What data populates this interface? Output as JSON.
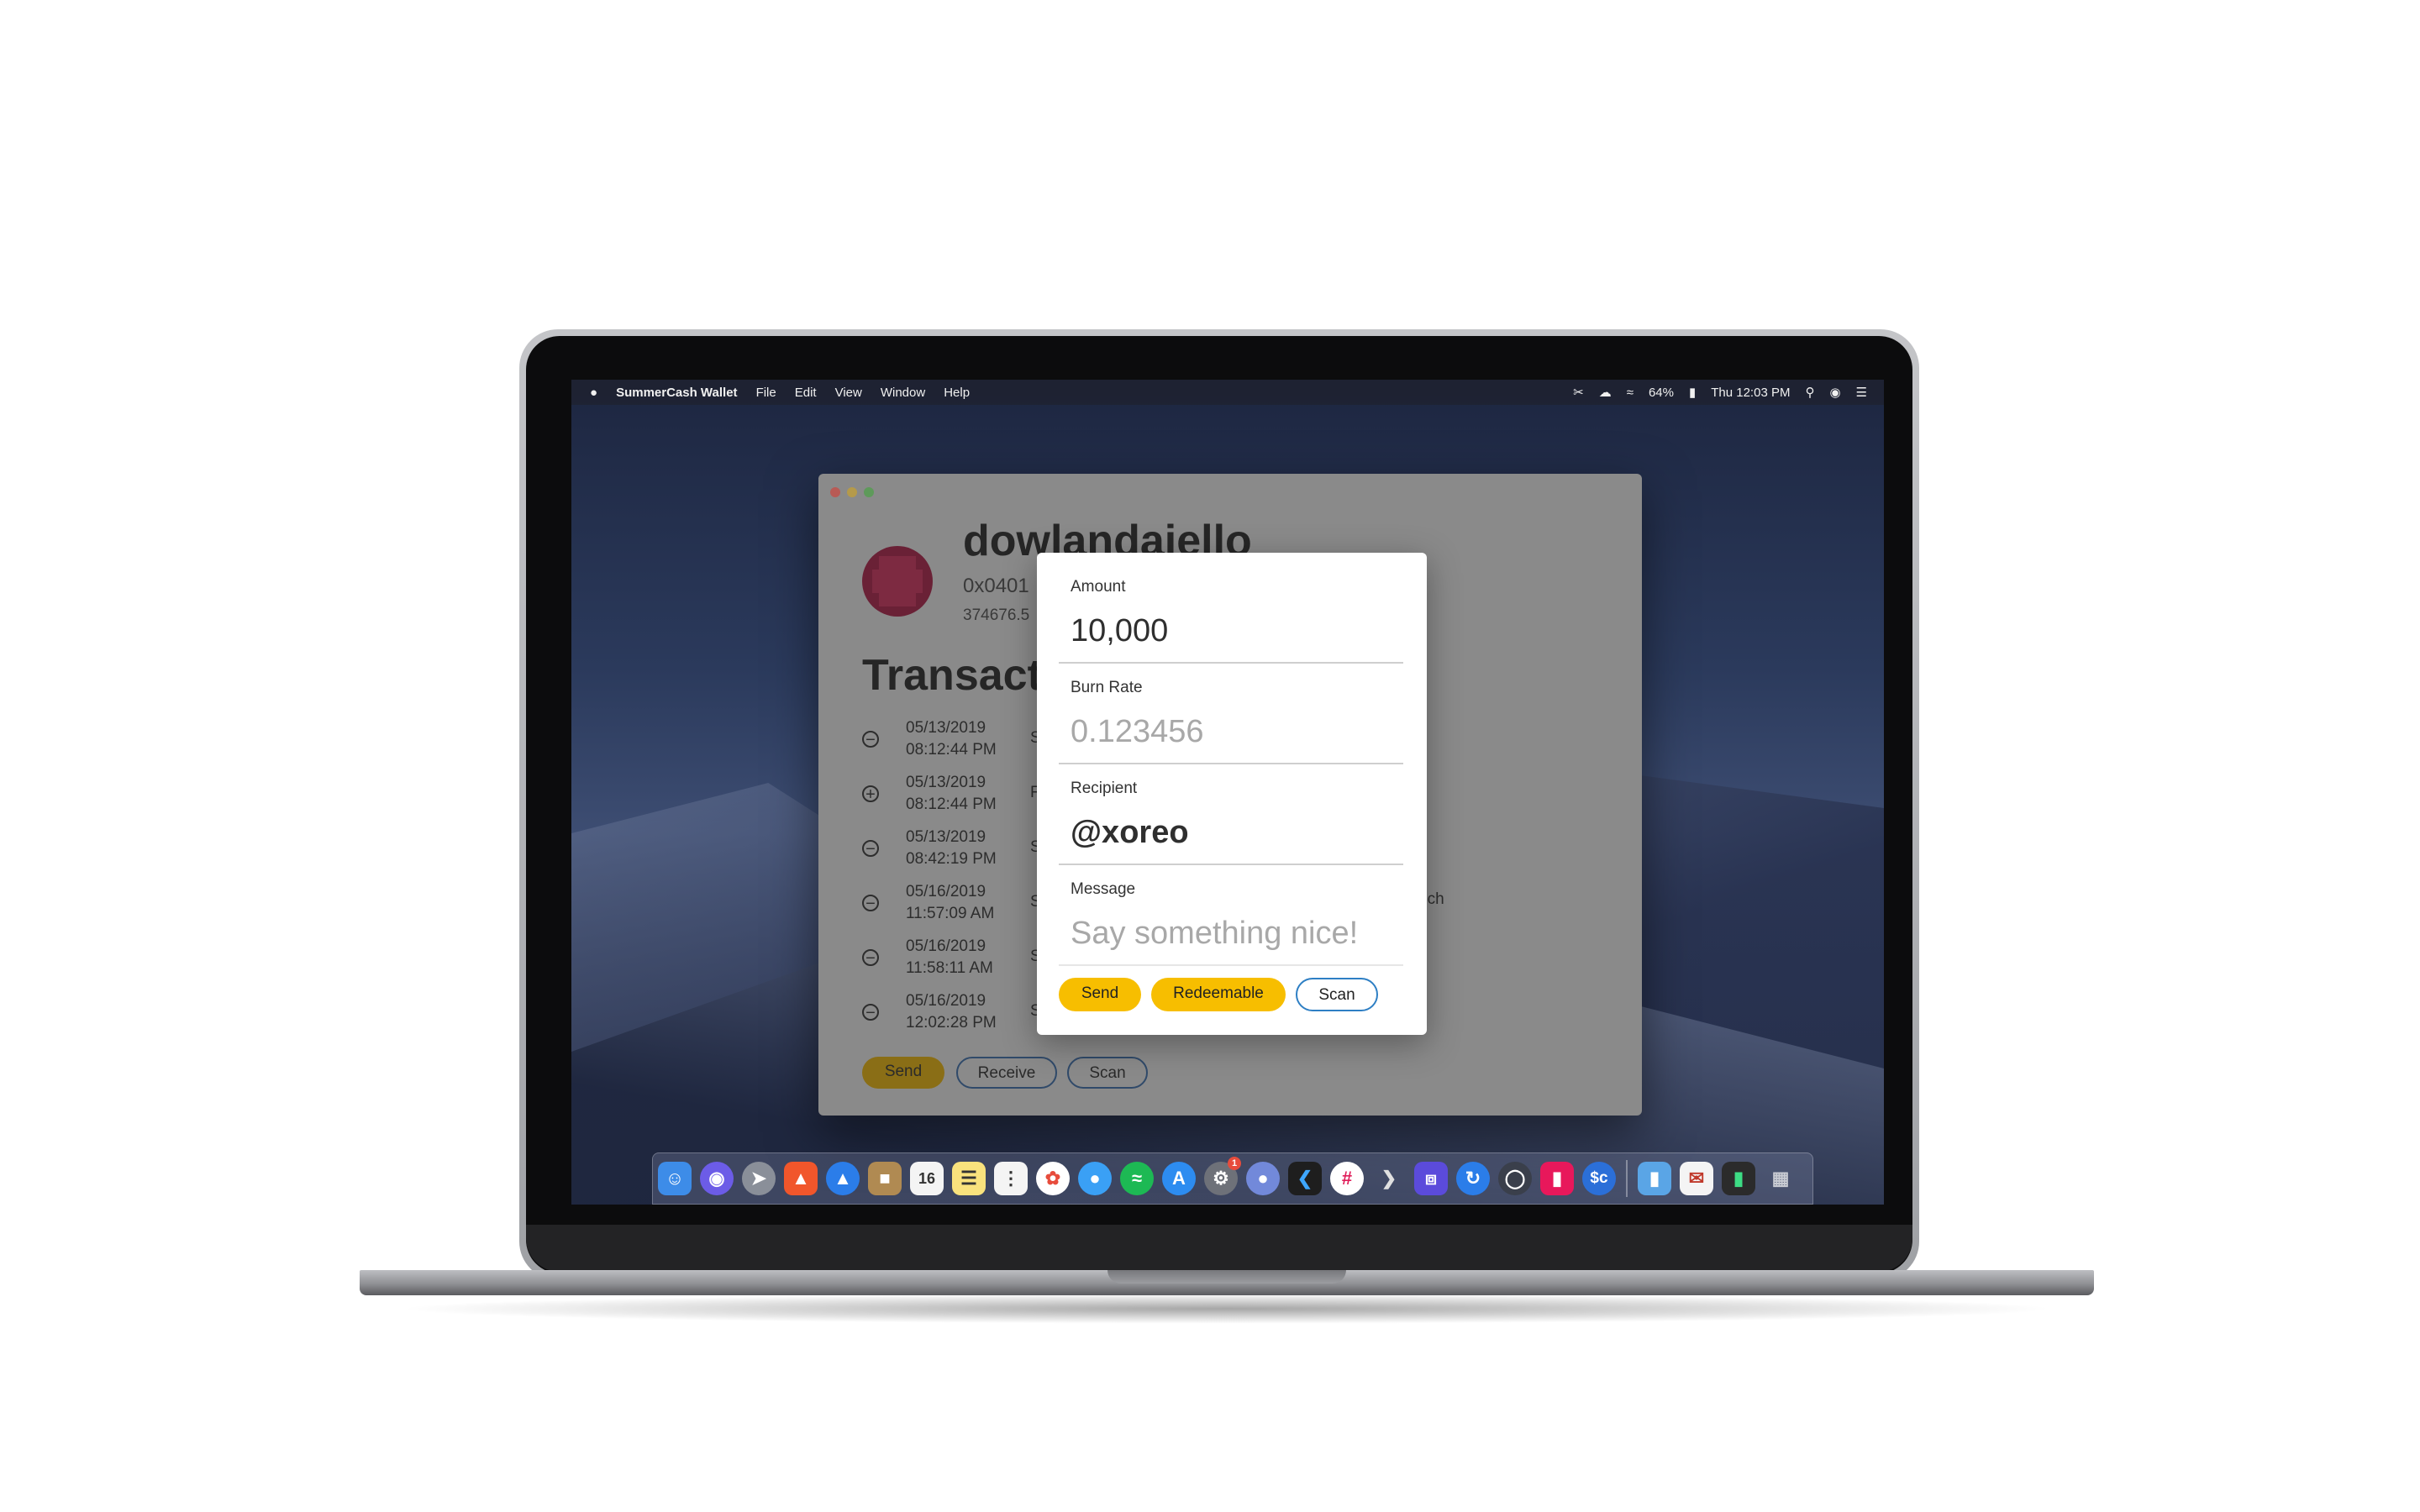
{
  "menubar": {
    "apple": "",
    "app_name": "SummerCash Wallet",
    "items": [
      "File",
      "Edit",
      "View",
      "Window",
      "Help"
    ],
    "battery": "64%",
    "clock": "Thu 12:03 PM"
  },
  "profile": {
    "username": "dowlandaiello",
    "address": "0x0401",
    "balance": "374676.5"
  },
  "transactions": {
    "heading": "Transact",
    "rows": [
      {
        "type": "minus",
        "date": "05/13/2019",
        "time": "08:12:44 PM",
        "glyph": "S"
      },
      {
        "type": "plus",
        "date": "05/13/2019",
        "time": "08:12:44 PM",
        "glyph": "F"
      },
      {
        "type": "minus",
        "date": "05/13/2019",
        "time": "08:42:19 PM",
        "glyph": "S"
      },
      {
        "type": "minus",
        "date": "05/16/2019",
        "time": "11:57:09 AM",
        "glyph": "S"
      },
      {
        "type": "minus",
        "date": "05/16/2019",
        "time": "11:58:11 AM",
        "glyph": "S"
      },
      {
        "type": "minus",
        "date": "05/16/2019",
        "time": "12:02:28 PM",
        "glyph": "S"
      }
    ],
    "overflow_text": "nch"
  },
  "window_buttons": {
    "send": "Send",
    "receive": "Receive",
    "scan": "Scan"
  },
  "modal": {
    "amount_label": "Amount",
    "amount_value": "10,000",
    "burn_label": "Burn Rate",
    "burn_placeholder": "0.123456",
    "recipient_label": "Recipient",
    "recipient_value": "@xoreo",
    "message_label": "Message",
    "message_placeholder": "Say something nice!",
    "send": "Send",
    "redeemable": "Redeemable",
    "scan": "Scan"
  },
  "colors": {
    "accent_yellow": "#f7be00",
    "scan_outline": "#2e7fc4",
    "window_overlay": "#8a8a8a"
  },
  "dock": {
    "icons": [
      "finder-icon",
      "siri-icon",
      "launchpad-icon",
      "brave-icon",
      "arc-icon",
      "notes-box-icon",
      "calendar-icon",
      "notes-icon",
      "reminders-icon",
      "photos-icon",
      "messages-icon",
      "spotify-icon",
      "app-store-icon",
      "system-preferences-icon",
      "discord-icon",
      "vscode-icon",
      "slack-icon",
      "prompt-icon",
      "linear-icon",
      "sync-icon",
      "vpn-icon",
      "tiles-icon",
      "summercash-icon",
      "folder-icon",
      "mail-icon",
      "terminal-icon",
      "trash-icon"
    ],
    "calendar_day": "16",
    "prefs_badge": "1",
    "summercash_label": "$c"
  }
}
